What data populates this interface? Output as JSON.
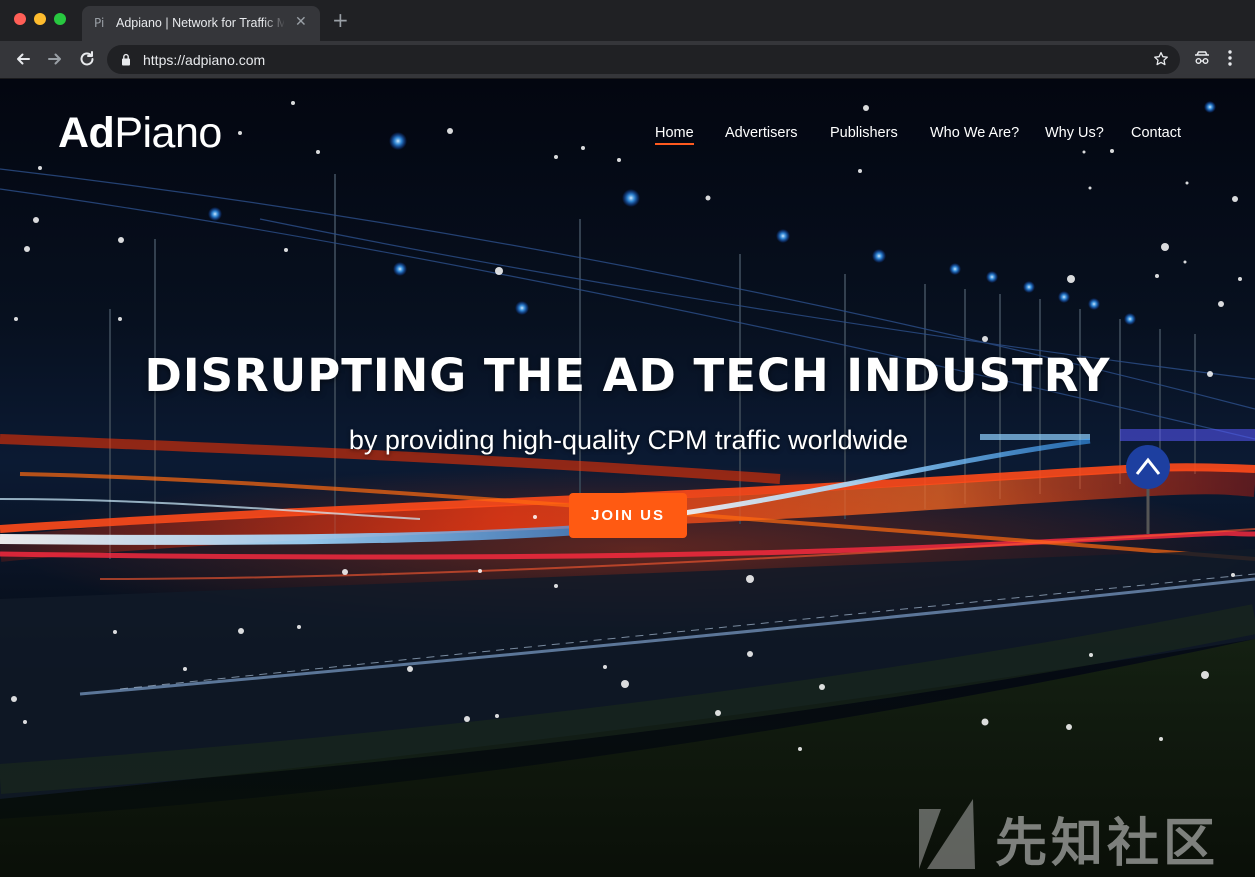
{
  "browser": {
    "tab": {
      "favicon": "Pi",
      "title": "Adpiano | Network for Traffic Monetization"
    },
    "url": {
      "scheme": "https://",
      "host": "adpiano.com"
    },
    "icons": [
      "back-arrow-icon",
      "forward-arrow-icon",
      "reload-icon",
      "lock-icon",
      "star-icon",
      "extension-icon",
      "menu-icon"
    ]
  },
  "site": {
    "logo": {
      "part1": "Ad",
      "part2": "Piano"
    },
    "nav": [
      {
        "label": "Home",
        "active": true
      },
      {
        "label": "Advertisers"
      },
      {
        "label": "Publishers"
      },
      {
        "label": "Who We Are?"
      },
      {
        "label": "Why Us?"
      },
      {
        "label": "Contact"
      }
    ],
    "hero": {
      "title": "DISRUPTING THE AD TECH INDUSTRY",
      "subtitle": "by providing high-quality CPM traffic worldwide",
      "cta": "JOIN US"
    },
    "watermark": "先知社区"
  },
  "colors": {
    "accent": "#ff5a12",
    "chrome_dark": "#202124",
    "chrome_toolbar": "#35363a"
  }
}
